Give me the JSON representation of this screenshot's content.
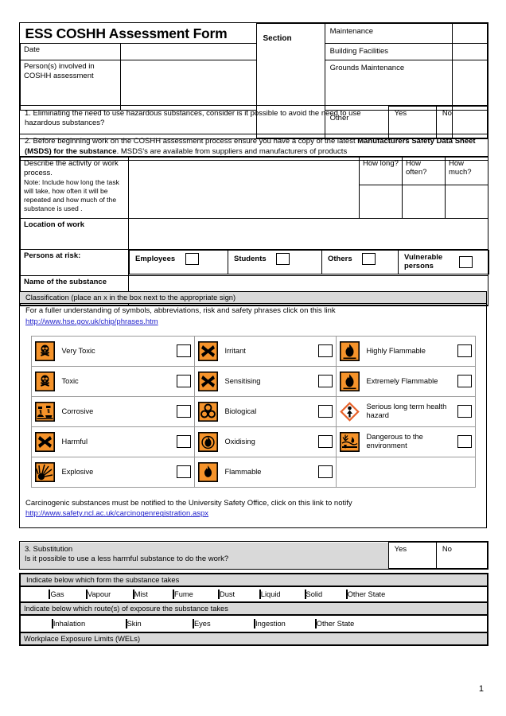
{
  "document": {
    "title": "ESS COSHH Assessment Form",
    "page_number": "1"
  },
  "header": {
    "date_label": "Date",
    "date_value": "",
    "persons_label": "Person(s) involved in COSHH assessment",
    "persons_value": "",
    "section_label": "Section",
    "section_options": [
      {
        "label": "Maintenance",
        "checked": ""
      },
      {
        "label": "Building Facilities",
        "checked": ""
      },
      {
        "label": "Grounds Maintenance",
        "checked": ""
      },
      {
        "label": "Other",
        "checked": ""
      }
    ]
  },
  "question1": {
    "text": "1. Eliminating the need to use hazardous substances, consider is it possible to avoid the need to use hazardous substances?",
    "yes_label": "Yes",
    "no_label": "No",
    "yes_value": "",
    "no_value": ""
  },
  "question2": {
    "text_part1": "2. Before beginning work on the COSHH assessment process ensure you have a copy of the latest ",
    "text_bold": "Manufacturers Safety Data Sheet (MSDS) for the substance",
    "text_part2": ". MSDS's are available from suppliers and manufacturers of products"
  },
  "activity": {
    "label": "Describe the activity or work process.",
    "note": "Note: Include how long the task will take, how often it will be repeated and how much of the substance is used .",
    "value": "",
    "columns": [
      {
        "header": "How long?",
        "value": ""
      },
      {
        "header": "How often?",
        "value": ""
      },
      {
        "header": "How much?",
        "value": ""
      }
    ]
  },
  "location": {
    "label": "Location of work",
    "value": ""
  },
  "persons_at_risk": {
    "label": "Persons at risk:",
    "options": [
      {
        "label": "Employees",
        "checked": ""
      },
      {
        "label": "Students",
        "checked": ""
      },
      {
        "label": "Others",
        "checked": ""
      },
      {
        "label": "Vulnerable persons",
        "checked": ""
      }
    ]
  },
  "substance_name": {
    "label": "Name of the substance",
    "value": ""
  },
  "classification": {
    "bar_label": "Classification (place an x in the box next to the appropriate sign)",
    "intro": "For a fuller understanding of symbols, abbreviations, risk and safety phrases click on this link",
    "link_text": "http://www.hse.gov.uk/chip/phrases.htm",
    "carcinogen_note": "Carcinogenic substances must be notified to the University Safety Office, click on this link to notify",
    "carcinogen_link": "http://www.safety.ncl.ac.uk/carcinogenregistration.aspx",
    "hazard_colors": {
      "orange": "#F5932A",
      "black": "#000000",
      "white": "#FFFFFF"
    },
    "rows": [
      [
        {
          "label": "Very Toxic",
          "icon": "skull-crossbones-icon",
          "checked": ""
        },
        {
          "label": "Irritant",
          "icon": "x-mark-icon",
          "checked": ""
        },
        {
          "label": "Highly Flammable",
          "icon": "flame-icon",
          "checked": ""
        }
      ],
      [
        {
          "label": "Toxic",
          "icon": "skull-crossbones-icon",
          "checked": ""
        },
        {
          "label": "Sensitising",
          "icon": "x-mark-icon",
          "checked": ""
        },
        {
          "label": "Extremely Flammable",
          "icon": "flame-icon",
          "checked": ""
        }
      ],
      [
        {
          "label": "Corrosive",
          "icon": "corrosive-icon",
          "checked": ""
        },
        {
          "label": "Biological",
          "icon": "biohazard-icon",
          "checked": ""
        },
        {
          "label": "Serious long term health hazard",
          "icon": "health-hazard-diamond-icon",
          "checked": ""
        }
      ],
      [
        {
          "label": "Harmful",
          "icon": "x-mark-icon",
          "checked": ""
        },
        {
          "label": "Oxidising",
          "icon": "oxidising-flame-icon",
          "checked": ""
        },
        {
          "label": "Dangerous to the environment",
          "icon": "environment-icon",
          "checked": ""
        }
      ],
      [
        {
          "label": "Explosive",
          "icon": "explosion-icon",
          "checked": ""
        },
        {
          "label": "Flammable",
          "icon": "flame-icon",
          "checked": ""
        },
        {
          "label": "",
          "icon": "",
          "checked": ""
        }
      ]
    ]
  },
  "question3": {
    "line1": "3. Substitution",
    "line2": "Is it possible to use a less harmful substance to do the work?",
    "yes_label": "Yes",
    "no_label": "No",
    "yes_value": "",
    "no_value": ""
  },
  "substance_form": {
    "bar_label": "Indicate below which form the substance takes",
    "options": [
      {
        "label": "Gas",
        "checked": ""
      },
      {
        "label": "Vapour",
        "checked": ""
      },
      {
        "label": "Mist",
        "checked": ""
      },
      {
        "label": "Fume",
        "checked": ""
      },
      {
        "label": "Dust",
        "checked": ""
      },
      {
        "label": "Liquid",
        "checked": ""
      },
      {
        "label": "Solid",
        "checked": ""
      },
      {
        "label": "Other  State",
        "checked": ""
      }
    ]
  },
  "exposure_routes": {
    "bar_label": "Indicate below which route(s) of exposure the substance takes",
    "options": [
      {
        "label": "Inhalation",
        "checked": ""
      },
      {
        "label": "Skin",
        "checked": ""
      },
      {
        "label": "Eyes",
        "checked": ""
      },
      {
        "label": "Ingestion",
        "checked": ""
      },
      {
        "label": "Other State",
        "checked": ""
      }
    ]
  },
  "wels": {
    "bar_label": "Workplace Exposure Limits (WELs)"
  }
}
